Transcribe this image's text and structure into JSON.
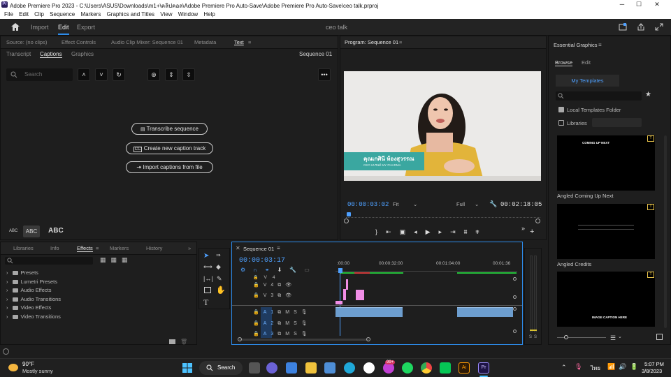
{
  "window": {
    "app_icon": "Pr",
    "title": "Adobe Premiere Pro 2023 - C:\\Users\\ASUS\\Downloads\\m1+\\คลิปคอล\\Adobe Premiere Pro Auto-Save\\Adobe Premiere Pro Auto-Save\\ceo talk.prproj",
    "minimize": "─",
    "maximize": "☐",
    "close": "✕"
  },
  "menu": [
    "File",
    "Edit",
    "Clip",
    "Sequence",
    "Markers",
    "Graphics and Titles",
    "View",
    "Window",
    "Help"
  ],
  "workspace": {
    "tabs": [
      "Import",
      "Edit",
      "Export"
    ],
    "active": "Edit",
    "project_title": "ceo talk"
  },
  "source_panel": {
    "tabs": [
      "Source: (no clips)",
      "Effect Controls",
      "Audio Clip Mixer: Sequence 01",
      "Metadata",
      "Text"
    ],
    "subtabs": [
      "Transcript",
      "Captions",
      "Graphics"
    ],
    "sequence_label": "Sequence 01",
    "search_placeholder": "Search",
    "buttons": {
      "transcribe": "Transcribe sequence",
      "create_track": "Create new caption track",
      "import_captions": "Import captions from file"
    },
    "text_size": [
      "ABC",
      "ABC",
      "ABC"
    ]
  },
  "program": {
    "tab": "Program: Sequence 01",
    "timecode": "00:00:03:02",
    "fit": "Fit",
    "quality": "Full",
    "duration": "00:02:18:05",
    "lower_third_name": "คุณเกศินี ห้องสุวรรณ",
    "lower_third_title": "CEO แบรนด์ MY PHARMA"
  },
  "effects_panel": {
    "tabs": [
      "Libraries",
      "Info",
      "Effects",
      "Markers",
      "History"
    ],
    "active": "Effects",
    "items": [
      "Presets",
      "Lumetri Presets",
      "Audio Effects",
      "Audio Transitions",
      "Video Effects",
      "Video Transitions"
    ]
  },
  "timeline": {
    "tab": "Sequence 01",
    "timecode": "00:00:03:17",
    "ruler": [
      ":00:00",
      "00:00:32:00",
      "00:01:04:00",
      "00:01:36"
    ],
    "video_tracks": [
      "V4",
      "V3"
    ],
    "audio_tracks": [
      "A1",
      "A2",
      "A3"
    ],
    "track_buttons": {
      "mute": "M",
      "solo": "S"
    },
    "meter_labels": [
      "S",
      "S"
    ]
  },
  "essential_graphics": {
    "title": "Essential Graphics",
    "tabs": [
      "Browse",
      "Edit"
    ],
    "active": "Browse",
    "my_templates": "My Templates",
    "local_templates": "Local Templates Folder",
    "libraries": "Libraries",
    "templates": [
      {
        "name": "Angled Coming Up Next",
        "caption": "COMING UP NEXT"
      },
      {
        "name": "Angled Credits",
        "caption": ""
      },
      {
        "name": "",
        "caption": "IMAGE CAPTION HERE"
      }
    ]
  },
  "taskbar": {
    "weather_temp": "90°F",
    "weather_desc": "Mostly sunny",
    "search": "Search",
    "badge": "99+",
    "lang": "ไทย",
    "time": "5:07 PM",
    "date": "3/8/2023"
  },
  "colors": {
    "accent_blue": "#2d8ceb",
    "timecode_blue": "#4ea0ff",
    "video_clip": "#f08ee6",
    "audio_clip": "#6d9ecf",
    "lower_third": "#3aa7a0"
  }
}
